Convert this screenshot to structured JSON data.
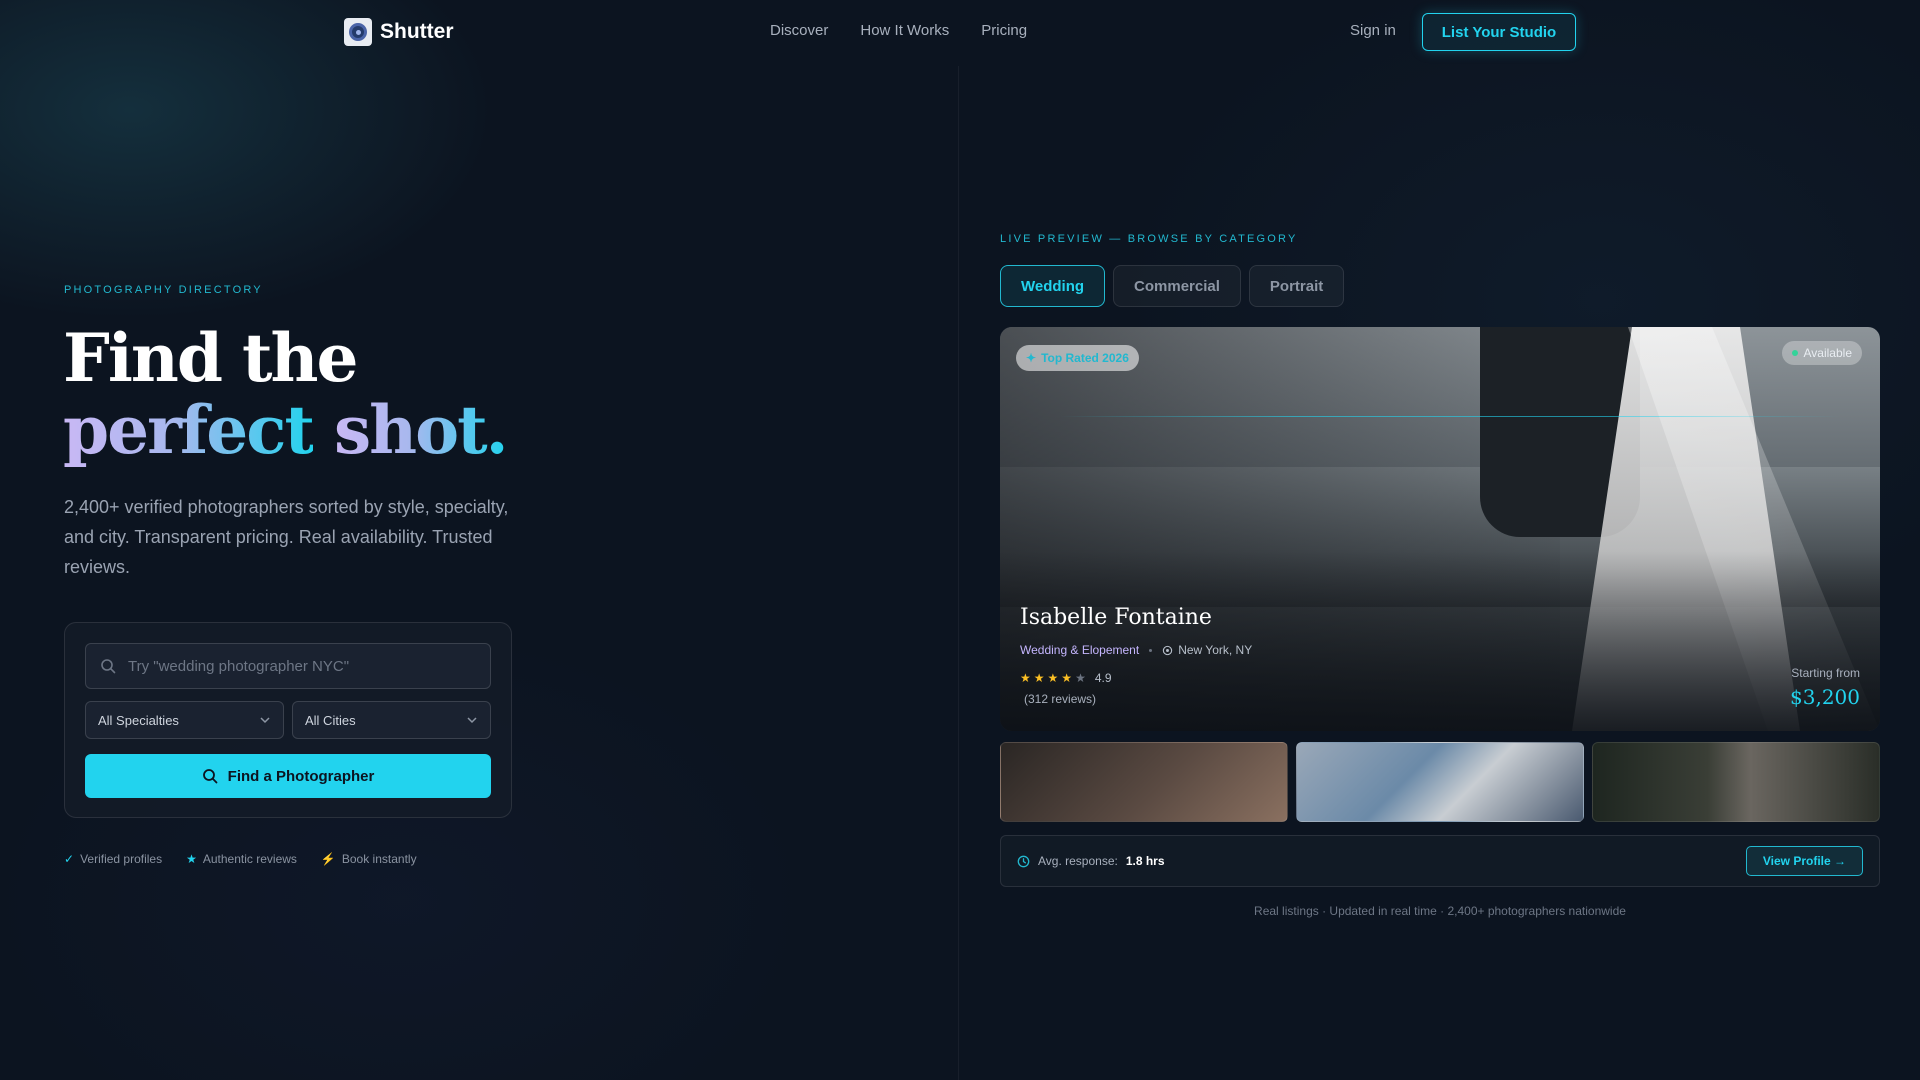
{
  "nav": {
    "brand": "Shutter",
    "links": [
      "Discover",
      "How It Works",
      "Pricing"
    ],
    "signin": "Sign in",
    "cta": "List Your Studio"
  },
  "hero": {
    "eyebrow": "PHOTOGRAPHY DIRECTORY",
    "title_line1": "Find the",
    "title_line2_a": "perfect",
    "title_line2_b": "shot.",
    "description": "2,400+ verified photographers sorted by style, specialty, and city. Transparent pricing. Real availability. Trusted reviews."
  },
  "search": {
    "placeholder": "Try \"wedding photographer NYC\"",
    "specialty": "All Specialties",
    "city": "All Cities",
    "button": "Find a Photographer"
  },
  "trust": [
    {
      "icon": "check-icon",
      "glyph": "✓",
      "label": "Verified profiles"
    },
    {
      "icon": "star-icon",
      "glyph": "★",
      "label": "Authentic reviews"
    },
    {
      "icon": "bolt-icon",
      "glyph": "⚡",
      "label": "Book instantly"
    }
  ],
  "preview": {
    "eyebrow": "LIVE PREVIEW — BROWSE BY CATEGORY",
    "tabs": [
      "Wedding",
      "Commercial",
      "Portrait"
    ],
    "active_tab": "Wedding",
    "badge": "Top Rated 2026",
    "availability": "Available",
    "name": "Isabelle Fontaine",
    "specialty": "Wedding & Elopement",
    "location": "New York, NY",
    "rating": "4.9",
    "rating_value": 4,
    "reviews": "(312 reviews)",
    "price_label": "Starting from",
    "price": "$3,200",
    "response_label": "Avg. response:",
    "response_value": "1.8 hrs",
    "view_button": "View Profile →",
    "footnote": "Real listings · Updated in real time · 2,400+ photographers nationwide"
  },
  "colors": {
    "accent": "#22d3ee",
    "background": "#0c1420",
    "lavender": "#c4b5fd",
    "star": "#fbbf24",
    "available": "#34d399"
  }
}
